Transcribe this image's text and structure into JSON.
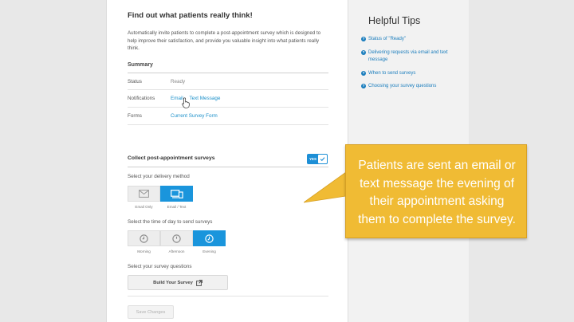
{
  "page": {
    "title": "Find out what patients really think!",
    "intro": "Automatically invite patients to complete a post-appointment survey which is designed to help improve their satisfaction, and provide you valuable insight into what patients really think."
  },
  "summary": {
    "heading": "Summary",
    "status_label": "Status",
    "status_value": "Ready",
    "notifications_label": "Notifications",
    "notifications_email": "Email",
    "notifications_sms": "Text Message",
    "forms_label": "Forms",
    "forms_link": "Current Survey Form"
  },
  "collect": {
    "label": "Collect post-appointment surveys",
    "toggle_label": "YES",
    "toggle_on": true
  },
  "delivery": {
    "question": "Select your delivery method",
    "options": [
      "Email Only",
      "Email / Text"
    ],
    "selected": "Email / Text"
  },
  "timing": {
    "question": "Select the time of day to send surveys",
    "options": [
      "Morning",
      "Afternoon",
      "Evening"
    ],
    "selected": "Evening"
  },
  "questions": {
    "question": "Select your survey questions",
    "build_button": "Build Your Survey"
  },
  "save_button": "Save Changes",
  "tips": {
    "title": "Helpful Tips",
    "items": [
      "Status of \"Ready\"",
      "Delivering requests via email and text message",
      "When to send surveys",
      "Choosing your survey questions"
    ]
  },
  "callout": {
    "text_lines": [
      "Patients are sent an email or",
      "text message the evening of",
      "their appointment asking",
      "them to complete the survey."
    ]
  },
  "colors": {
    "accent": "#1a95dc",
    "link": "#1a8fc9",
    "callout": "#f0bb34"
  }
}
